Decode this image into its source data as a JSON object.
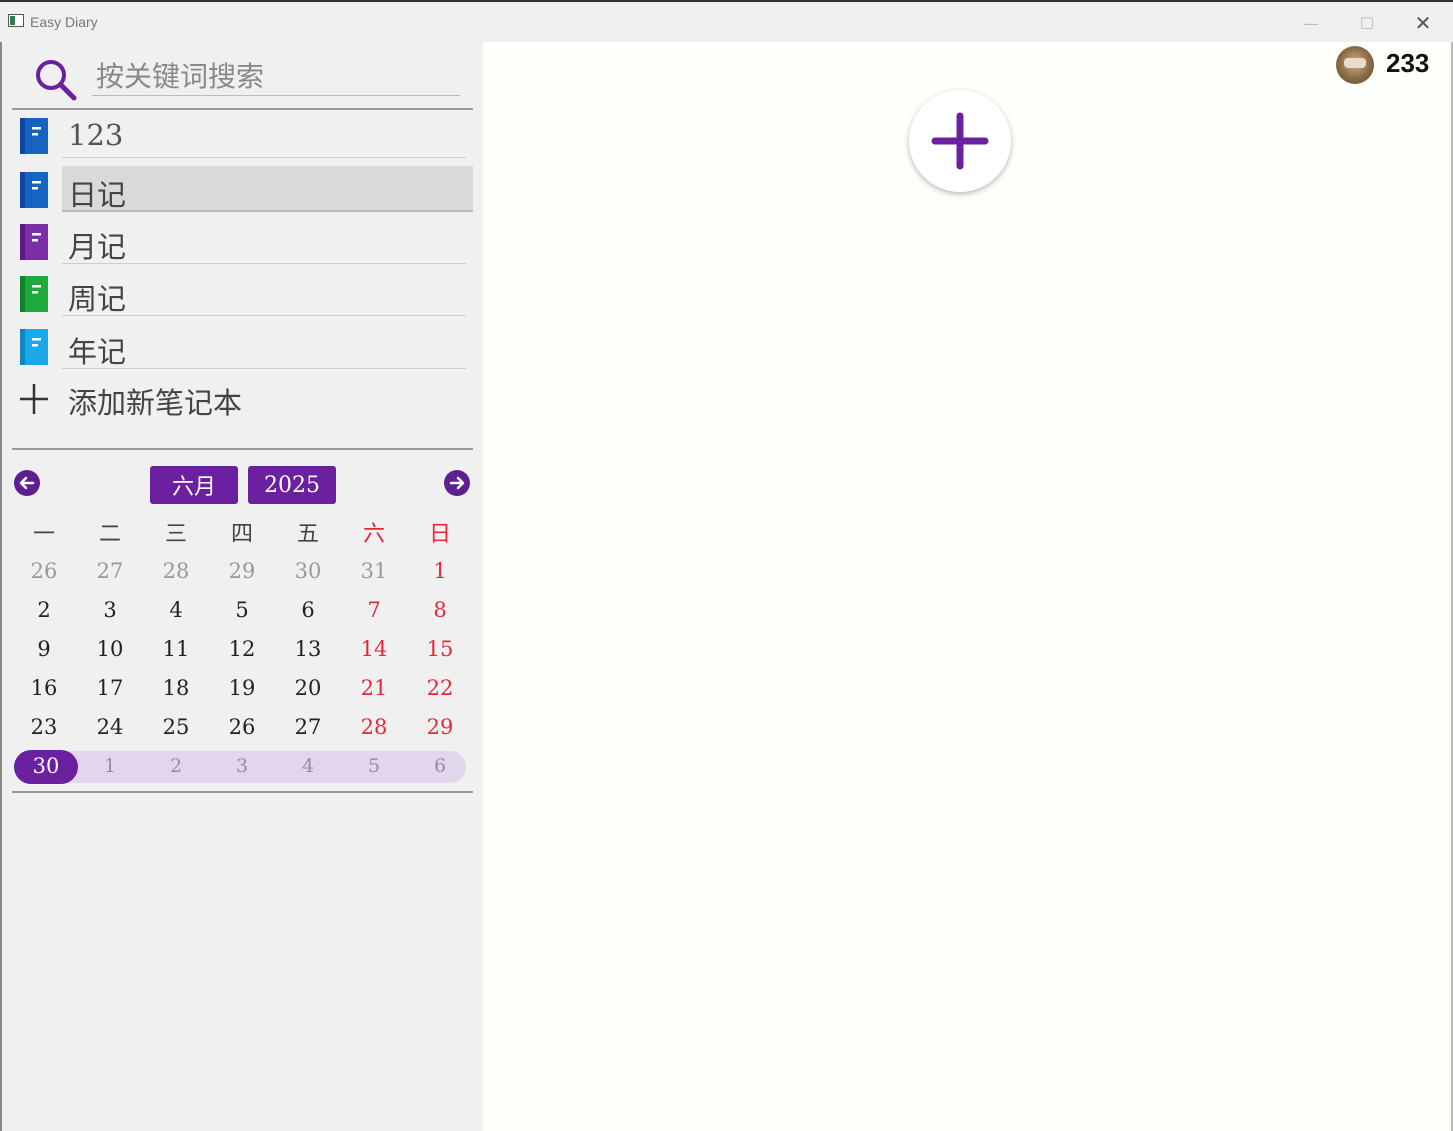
{
  "window": {
    "title": "Easy Diary",
    "minimize": "—",
    "maximize": "☐",
    "close": "✕"
  },
  "search": {
    "placeholder": "按关键词搜索"
  },
  "notebooks": {
    "items": [
      {
        "label": "123",
        "color": "#1565c0"
      },
      {
        "label": "日记",
        "color": "#1565c0",
        "selected": true
      },
      {
        "label": "月记",
        "color": "#7b2fa6"
      },
      {
        "label": "周记",
        "color": "#1eaa3c"
      },
      {
        "label": "年记",
        "color": "#1aa8e8"
      }
    ],
    "add_label": "添加新笔记本"
  },
  "calendar": {
    "month": "六月",
    "year": "2025",
    "weekdays": [
      "一",
      "二",
      "三",
      "四",
      "五",
      "六",
      "日"
    ],
    "weeks": [
      [
        "26",
        "27",
        "28",
        "29",
        "30",
        "31",
        "1"
      ],
      [
        "2",
        "3",
        "4",
        "5",
        "6",
        "7",
        "8"
      ],
      [
        "9",
        "10",
        "11",
        "12",
        "13",
        "14",
        "15"
      ],
      [
        "16",
        "17",
        "18",
        "19",
        "20",
        "21",
        "22"
      ],
      [
        "23",
        "24",
        "25",
        "26",
        "27",
        "28",
        "29"
      ],
      [
        "30",
        "1",
        "2",
        "3",
        "4",
        "5",
        "6"
      ]
    ],
    "today": "30",
    "accent_color": "#6b20a0",
    "weekend_color": "#e8273a"
  },
  "user": {
    "name": "233"
  }
}
